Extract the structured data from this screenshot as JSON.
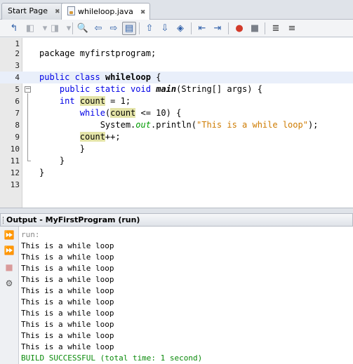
{
  "tabs": [
    {
      "label": "Start Page",
      "active": false
    },
    {
      "label": "whileloop.java",
      "active": true
    }
  ],
  "toolbar": {
    "icons": [
      "last-edit-icon",
      "back-icon",
      "forward-icon",
      "find-icon",
      "find-previous-icon",
      "find-next-icon",
      "toggle-highlight-icon",
      "previous-bookmark-icon",
      "next-bookmark-icon",
      "toggle-bookmark-icon",
      "shift-left-icon",
      "shift-right-icon",
      "start-macro-icon",
      "stop-macro-icon",
      "comment-icon",
      "uncomment-icon"
    ]
  },
  "editor": {
    "lines": [
      {
        "n": "1",
        "code": ""
      },
      {
        "n": "2",
        "code": "package myfirstprogram;"
      },
      {
        "n": "3",
        "code": ""
      },
      {
        "n": "4",
        "code": "public class whileloop {"
      },
      {
        "n": "5",
        "code": "    public static void main(String[] args) {"
      },
      {
        "n": "6",
        "code": "    int count = 1;"
      },
      {
        "n": "7",
        "code": "        while(count <= 10) {"
      },
      {
        "n": "8",
        "code": "            System.out.println(\"This is a while loop\");"
      },
      {
        "n": "9",
        "code": "        count++;"
      },
      {
        "n": "10",
        "code": "        }"
      },
      {
        "n": "11",
        "code": "    }"
      },
      {
        "n": "12",
        "code": "}"
      },
      {
        "n": "13",
        "code": ""
      }
    ]
  },
  "output": {
    "title": "Output - MyFirstProgram (run)",
    "lines": [
      "run:",
      "This is a while loop",
      "This is a while loop",
      "This is a while loop",
      "This is a while loop",
      "This is a while loop",
      "This is a while loop",
      "This is a while loop",
      "This is a while loop",
      "This is a while loop",
      "This is a while loop",
      "BUILD SUCCESSFUL (total time: 1 second)"
    ]
  },
  "colors": {
    "keyword": "#0000e6",
    "string": "#ce7b00",
    "field": "#009b00",
    "highlight": "#e4e4a8",
    "success": "#0a8a0a"
  }
}
